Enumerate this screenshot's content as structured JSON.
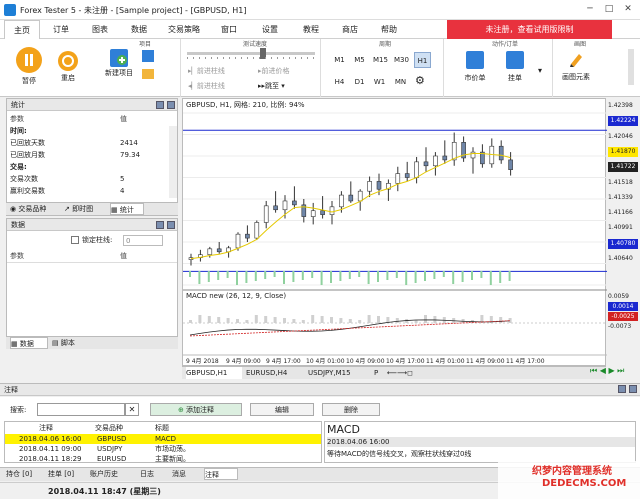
{
  "window": {
    "title": "Forex Tester 5 - 未注册 - [Sample project] - [GBPUSD, H1]"
  },
  "menu": {
    "items": [
      "主页",
      "订单",
      "图表",
      "数据",
      "交易策略",
      "窗口",
      "设置",
      "教程",
      "商店",
      "帮助"
    ],
    "unregistered": "未注册，查看试用版限制"
  },
  "ribbon": {
    "pause": "暂停",
    "restart": "重启",
    "new_project": "新建项目",
    "group_project": "项目",
    "speed_label": "测试速度",
    "step_bar": "前进柱线",
    "step_tick": "前进价格",
    "rewind": "跳至",
    "timeframes_row1": [
      "M1",
      "M5",
      "M15",
      "M30",
      "H1"
    ],
    "timeframes_row2": [
      "H4",
      "D1",
      "W1",
      "MN"
    ],
    "group_period": "周期",
    "group_action": "动作/订单",
    "group_draw": "画图",
    "market": "市价单",
    "pending": "挂单",
    "draw_elements": "画图元素"
  },
  "stats": {
    "title": "统计",
    "headers": [
      "参数",
      "值"
    ],
    "rows": [
      {
        "k": "时间:",
        "v": "",
        "bold": true
      },
      {
        "k": "已回放天数",
        "v": "2414"
      },
      {
        "k": "已回放月数",
        "v": "79.34"
      },
      {
        "k": "交易:",
        "v": "",
        "bold": true
      },
      {
        "k": "交易次数",
        "v": "5"
      },
      {
        "k": "赢利交易数",
        "v": "4"
      }
    ],
    "tabs": [
      "交易品种",
      "即时图",
      "统计"
    ]
  },
  "data_panel": {
    "title": "数据",
    "lock": "锁定柱线:",
    "lock_value": "0",
    "headers": [
      "参数",
      "值"
    ],
    "tabs": [
      "数据",
      "脚本"
    ]
  },
  "chart": {
    "header": "GBPUSD, H1, 网格: 210, 比例: 94%",
    "macd_header": "MACD new (26, 12, 9, Close)",
    "price_labels": [
      "1.42398",
      "1.42224",
      "1.42046",
      "1.41870",
      "1.41722",
      "1.41518",
      "1.41339",
      "1.41166",
      "1.40991",
      "1.40780",
      "1.40640"
    ],
    "highlighted": {
      "upper": "1.42224",
      "bid": "1.41870",
      "ask": "1.41722",
      "lower": "1.40780"
    },
    "macd_labels": [
      "0.0059",
      "0.0014",
      "-0.0025",
      "-0.0073"
    ],
    "time_labels": [
      "9 4月 2018",
      "9 4月 09:00",
      "9 4月 17:00",
      "10 4月 01:00",
      "10 4月 09:00",
      "10 4月 17:00",
      "11 4月 01:00",
      "11 4月 09:00",
      "11 4月 17:00"
    ],
    "tabs": [
      "GBPUSD,H1",
      "EURUSD,H4",
      "USDJPY,M15",
      "P"
    ],
    "colors": {
      "up": "#ffffff",
      "down": "#6f86a8",
      "ma": "#e5c900",
      "hline": "#1a28d0",
      "macd": "#222222",
      "signal": "#d22222"
    }
  },
  "chart_data": {
    "type": "candlestick",
    "x_ticks": [
      "9 4月 2018",
      "9 4月 09:00",
      "9 4月 17:00",
      "10 4月 01:00",
      "10 4月 09:00",
      "10 4月 17:00",
      "11 4月 01:00",
      "11 4月 09:00",
      "11 4月 17:00"
    ],
    "ylim": [
      1.4064,
      1.424
    ],
    "hlines": [
      1.42224,
      1.4078
    ],
    "ohlc_approx": [
      [
        1.409,
        1.4096,
        1.4084,
        1.4092
      ],
      [
        1.4092,
        1.41,
        1.4088,
        1.4095
      ],
      [
        1.4095,
        1.4103,
        1.4092,
        1.4101
      ],
      [
        1.4101,
        1.4108,
        1.4096,
        1.4098
      ],
      [
        1.4098,
        1.4104,
        1.4092,
        1.4102
      ],
      [
        1.4102,
        1.4118,
        1.4099,
        1.4116
      ],
      [
        1.4116,
        1.4125,
        1.4108,
        1.4112
      ],
      [
        1.4112,
        1.413,
        1.411,
        1.4128
      ],
      [
        1.4128,
        1.415,
        1.4122,
        1.4145
      ],
      [
        1.4145,
        1.416,
        1.4138,
        1.4141
      ],
      [
        1.4141,
        1.4156,
        1.4132,
        1.415
      ],
      [
        1.415,
        1.4165,
        1.4142,
        1.4146
      ],
      [
        1.4146,
        1.4152,
        1.4128,
        1.4134
      ],
      [
        1.4134,
        1.4148,
        1.4126,
        1.414
      ],
      [
        1.414,
        1.4155,
        1.4132,
        1.4136
      ],
      [
        1.4136,
        1.415,
        1.4126,
        1.4144
      ],
      [
        1.4144,
        1.416,
        1.4138,
        1.4156
      ],
      [
        1.4156,
        1.417,
        1.4148,
        1.415
      ],
      [
        1.415,
        1.4162,
        1.414,
        1.416
      ],
      [
        1.416,
        1.4175,
        1.4154,
        1.417
      ],
      [
        1.417,
        1.4178,
        1.4156,
        1.4162
      ],
      [
        1.4162,
        1.4172,
        1.415,
        1.4168
      ],
      [
        1.4168,
        1.4185,
        1.416,
        1.4178
      ],
      [
        1.4178,
        1.419,
        1.417,
        1.4174
      ],
      [
        1.4174,
        1.4195,
        1.4168,
        1.419
      ],
      [
        1.419,
        1.4205,
        1.418,
        1.4186
      ],
      [
        1.4186,
        1.42,
        1.4176,
        1.4196
      ],
      [
        1.4196,
        1.4212,
        1.4188,
        1.4192
      ],
      [
        1.4192,
        1.422,
        1.4186,
        1.421
      ],
      [
        1.421,
        1.4216,
        1.419,
        1.4194
      ],
      [
        1.4194,
        1.4205,
        1.4178,
        1.42
      ],
      [
        1.42,
        1.4208,
        1.4184,
        1.4188
      ],
      [
        1.4188,
        1.4214,
        1.4184,
        1.4206
      ],
      [
        1.4206,
        1.4212,
        1.4188,
        1.4192
      ],
      [
        1.4192,
        1.42,
        1.4176,
        1.4182
      ]
    ]
  },
  "notes": {
    "title": "注释",
    "search_label": "搜索:",
    "add": "添加注释",
    "edit": "编辑",
    "delete": "删除",
    "headers": [
      "注释",
      "交易品种",
      "标题"
    ],
    "rows": [
      {
        "date": "2018.04.06 16:00",
        "sym": "GBPUSD",
        "title": "MACD",
        "selected": true
      },
      {
        "date": "2018.04.11 09:00",
        "sym": "USDJPY",
        "title": "市场动荡。"
      },
      {
        "date": "2018.04.11 18:29",
        "sym": "EURUSD",
        "title": "主要新闻。"
      }
    ],
    "detail": {
      "heading": "MACD",
      "date": "2018.04.06 16:00",
      "text": "等待MACD的信号线交叉，观察柱状线穿过0线"
    }
  },
  "bottom_tabs": [
    "持仓 [0]",
    "挂单 [0]",
    "账户历史",
    "日志",
    "消息",
    "注释"
  ],
  "status": {
    "time": "2018.04.11 18:47 (星期三)"
  },
  "watermark": {
    "line1": "织梦内容管理系统",
    "line2": "DEDECMS.COM"
  }
}
